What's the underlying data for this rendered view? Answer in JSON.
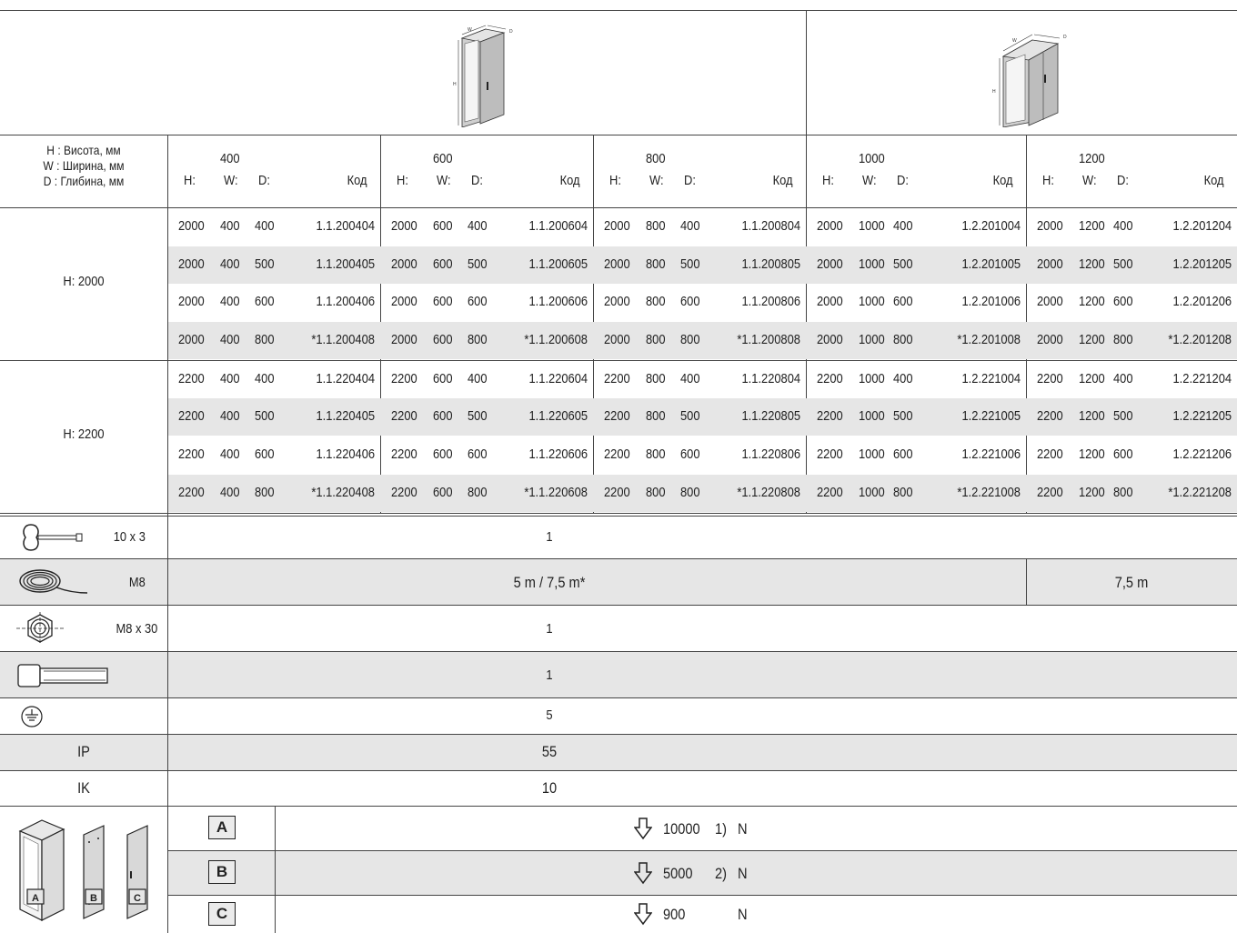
{
  "legend": {
    "h": "H : Висота, мм",
    "w": "W : Ширина, мм",
    "d": "D : Глибина, мм"
  },
  "col_labels": {
    "h": "H:",
    "w": "W:",
    "d": "D:",
    "code": "Код"
  },
  "widths": [
    "400",
    "600",
    "800",
    "1000",
    "1200"
  ],
  "diagram_labels": {
    "w": "W",
    "d": "D",
    "h": "H"
  },
  "row_groups": [
    {
      "label": "H: 2000",
      "rows": [
        [
          [
            "2000",
            "400",
            "400",
            "1.1.200404"
          ],
          [
            "2000",
            "600",
            "400",
            "1.1.200604"
          ],
          [
            "2000",
            "800",
            "400",
            "1.1.200804"
          ],
          [
            "2000",
            "1000",
            "400",
            "1.2.201004"
          ],
          [
            "2000",
            "1200",
            "400",
            "1.2.201204"
          ]
        ],
        [
          [
            "2000",
            "400",
            "500",
            "1.1.200405"
          ],
          [
            "2000",
            "600",
            "500",
            "1.1.200605"
          ],
          [
            "2000",
            "800",
            "500",
            "1.1.200805"
          ],
          [
            "2000",
            "1000",
            "500",
            "1.2.201005"
          ],
          [
            "2000",
            "1200",
            "500",
            "1.2.201205"
          ]
        ],
        [
          [
            "2000",
            "400",
            "600",
            "1.1.200406"
          ],
          [
            "2000",
            "600",
            "600",
            "1.1.200606"
          ],
          [
            "2000",
            "800",
            "600",
            "1.1.200806"
          ],
          [
            "2000",
            "1000",
            "600",
            "1.2.201006"
          ],
          [
            "2000",
            "1200",
            "600",
            "1.2.201206"
          ]
        ],
        [
          [
            "2000",
            "400",
            "800",
            "*1.1.200408"
          ],
          [
            "2000",
            "600",
            "800",
            "*1.1.200608"
          ],
          [
            "2000",
            "800",
            "800",
            "*1.1.200808"
          ],
          [
            "2000",
            "1000",
            "800",
            "*1.2.201008"
          ],
          [
            "2000",
            "1200",
            "800",
            "*1.2.201208"
          ]
        ]
      ]
    },
    {
      "label": "H: 2200",
      "rows": [
        [
          [
            "2200",
            "400",
            "400",
            "1.1.220404"
          ],
          [
            "2200",
            "600",
            "400",
            "1.1.220604"
          ],
          [
            "2200",
            "800",
            "400",
            "1.1.220804"
          ],
          [
            "2200",
            "1000",
            "400",
            "1.2.221004"
          ],
          [
            "2200",
            "1200",
            "400",
            "1.2.221204"
          ]
        ],
        [
          [
            "2200",
            "400",
            "500",
            "1.1.220405"
          ],
          [
            "2200",
            "600",
            "500",
            "1.1.220605"
          ],
          [
            "2200",
            "800",
            "500",
            "1.1.220805"
          ],
          [
            "2200",
            "1000",
            "500",
            "1.2.221005"
          ],
          [
            "2200",
            "1200",
            "500",
            "1.2.221205"
          ]
        ],
        [
          [
            "2200",
            "400",
            "600",
            "1.1.220406"
          ],
          [
            "2200",
            "600",
            "600",
            "1.1.220606"
          ],
          [
            "2200",
            "800",
            "600",
            "1.1.220806"
          ],
          [
            "2200",
            "1000",
            "600",
            "1.2.221006"
          ],
          [
            "2200",
            "1200",
            "600",
            "1.2.221206"
          ]
        ],
        [
          [
            "2200",
            "400",
            "800",
            "*1.1.220408"
          ],
          [
            "2200",
            "600",
            "800",
            "*1.1.220608"
          ],
          [
            "2200",
            "800",
            "800",
            "*1.1.220808"
          ],
          [
            "2200",
            "1000",
            "800",
            "*1.2.221008"
          ],
          [
            "2200",
            "1200",
            "800",
            "*1.2.221208"
          ]
        ]
      ]
    }
  ],
  "accessories": {
    "key": {
      "label": "10 x 3",
      "value": "1",
      "icon": "key-icon"
    },
    "cable": {
      "label": "M8",
      "value_main": "5 m / 7,5 m*",
      "value_last": "7,5 m",
      "icon": "cable-coil-icon"
    },
    "nut": {
      "label": "M8 x 30",
      "value": "1",
      "icon": "nut-icon"
    },
    "screw": {
      "value": "1",
      "icon": "screw-icon"
    },
    "earth": {
      "value": "5",
      "icon": "earth-ground-icon"
    },
    "ip": {
      "label": "IP",
      "value": "55"
    },
    "ik": {
      "label": "IK",
      "value": "10"
    }
  },
  "loads": [
    {
      "letter": "A",
      "value": "10000",
      "note": "1)",
      "unit": "N"
    },
    {
      "letter": "B",
      "value": "5000",
      "note": "2)",
      "unit": "N"
    },
    {
      "letter": "C",
      "value": "900",
      "note": "",
      "unit": "N"
    }
  ]
}
